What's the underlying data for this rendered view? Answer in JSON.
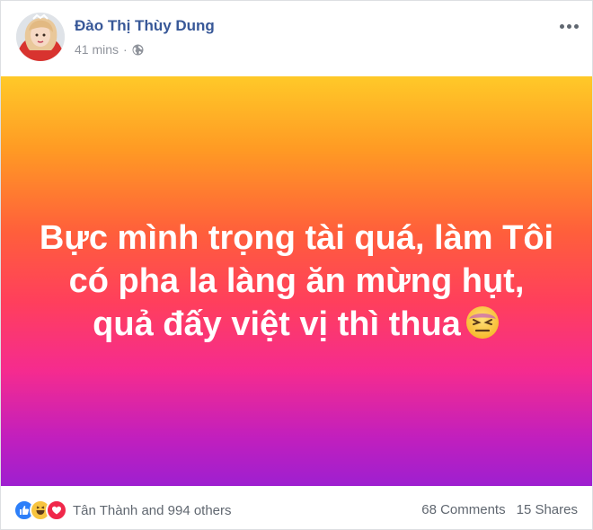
{
  "post": {
    "author": "Đào Thị Thùy Dung",
    "time": "41 mins",
    "separator": "·",
    "privacy_icon": "globe-icon",
    "more_icon": "more-options-icon",
    "banner": {
      "lines": [
        "Bực mình trọng tài quá, làm Tôi",
        "có pha la làng ăn mừng hụt,",
        "quả đấy việt vị thì thua"
      ],
      "emoji": "persevering-face-emoji",
      "colors": [
        "#ffc928",
        "#ff9a24",
        "#ff5f3b",
        "#ff3f5c",
        "#f52b8f",
        "#c21fbd",
        "#9e1fd0"
      ]
    },
    "reactions": {
      "icons": [
        "like-icon",
        "haha-icon",
        "love-icon"
      ],
      "summary": "Tân Thành and 994 others"
    },
    "comments": "68 Comments",
    "shares": "15 Shares",
    "accent": "#385898"
  }
}
